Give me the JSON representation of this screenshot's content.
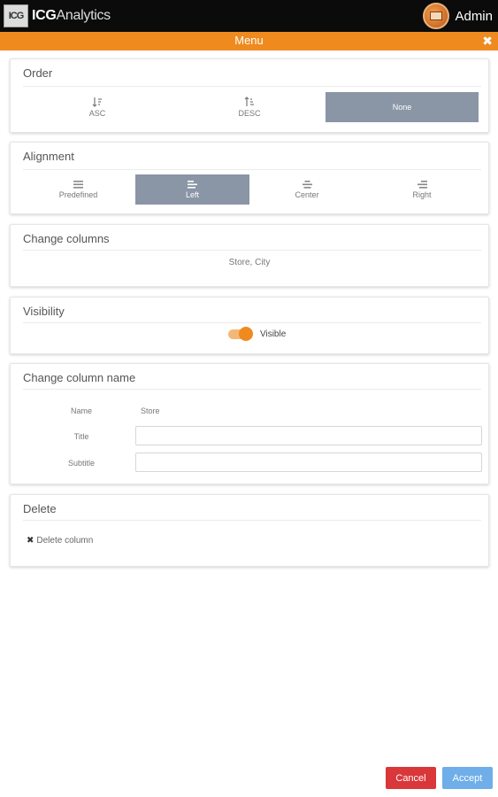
{
  "app": {
    "logo_mark": "ICG",
    "name_bold": "ICG",
    "name_rest": "Analytics",
    "user_name": "Admin"
  },
  "menu": {
    "title": "Menu",
    "close_symbol": "✖"
  },
  "order": {
    "title": "Order",
    "options": [
      {
        "label": "ASC",
        "icon": "sort-asc-icon",
        "selected": false
      },
      {
        "label": "DESC",
        "icon": "sort-desc-icon",
        "selected": false
      },
      {
        "label": "None",
        "icon": "",
        "selected": true
      }
    ]
  },
  "alignment": {
    "title": "Alignment",
    "options": [
      {
        "label": "Predefined",
        "icon": "align-justify-icon",
        "selected": false
      },
      {
        "label": "Left",
        "icon": "align-left-icon",
        "selected": true
      },
      {
        "label": "Center",
        "icon": "align-center-icon",
        "selected": false
      },
      {
        "label": "Right",
        "icon": "align-right-icon",
        "selected": false
      }
    ]
  },
  "change_columns": {
    "title": "Change columns",
    "value": "Store, City"
  },
  "visibility": {
    "title": "Visibility",
    "toggle_label": "Visible",
    "toggle_on": true
  },
  "change_column_name": {
    "title": "Change column name",
    "name_label": "Name",
    "name_value": "Store",
    "title_label": "Title",
    "title_value": "",
    "subtitle_label": "Subtitle",
    "subtitle_value": ""
  },
  "delete": {
    "title": "Delete",
    "link_icon": "✖",
    "link_label": "Delete column"
  },
  "footer": {
    "cancel_label": "Cancel",
    "accept_label": "Accept"
  },
  "colors": {
    "accent": "#ef8a1f",
    "selected": "#8a95a6",
    "cancel": "#d9373a",
    "accept": "#6faee8"
  }
}
